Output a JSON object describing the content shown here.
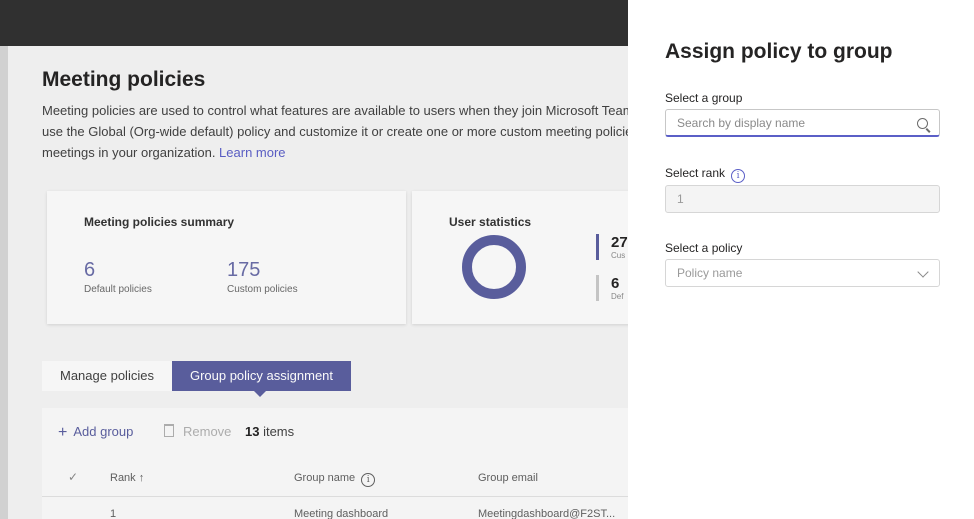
{
  "page": {
    "title": "Meeting policies",
    "description_lines": [
      "Meeting policies are used to control what features are available to users when they join Microsoft Teams meetings. You can",
      "use the Global (Org-wide default) policy and customize it or create one or more custom meeting policies for people that host"
    ],
    "description_last": "meetings in your organization. ",
    "learn_more": "Learn more"
  },
  "summary_card": {
    "title": "Meeting policies summary",
    "default_value": "6",
    "default_label": "Default policies",
    "custom_value": "175",
    "custom_label": "Custom policies"
  },
  "user_stats_card": {
    "title": "User statistics",
    "stat1_value": "27",
    "stat1_label": "Cus",
    "stat2_value": "6",
    "stat2_label": "Def"
  },
  "tabs": [
    {
      "label": "Manage policies",
      "active": false
    },
    {
      "label": "Group policy assignment",
      "active": true
    }
  ],
  "toolbar": {
    "add_label": "Add group",
    "remove_label": "Remove",
    "count_value": "13",
    "count_label": " items"
  },
  "table": {
    "columns": [
      "Rank",
      "Group name",
      "Group email"
    ],
    "partial_row": [
      "1",
      "Meeting dashboard",
      "Meetingdashboard@F2ST..."
    ]
  },
  "panel": {
    "title": "Assign policy to group",
    "group_label": "Select a group",
    "group_placeholder": "Search by display name",
    "rank_label": "Select rank",
    "rank_value": "1",
    "policy_label": "Select a policy",
    "policy_placeholder": "Policy name"
  },
  "colors": {
    "accent": "#5b5fa0",
    "link": "#5b5fc7",
    "topbar": "#313131"
  }
}
